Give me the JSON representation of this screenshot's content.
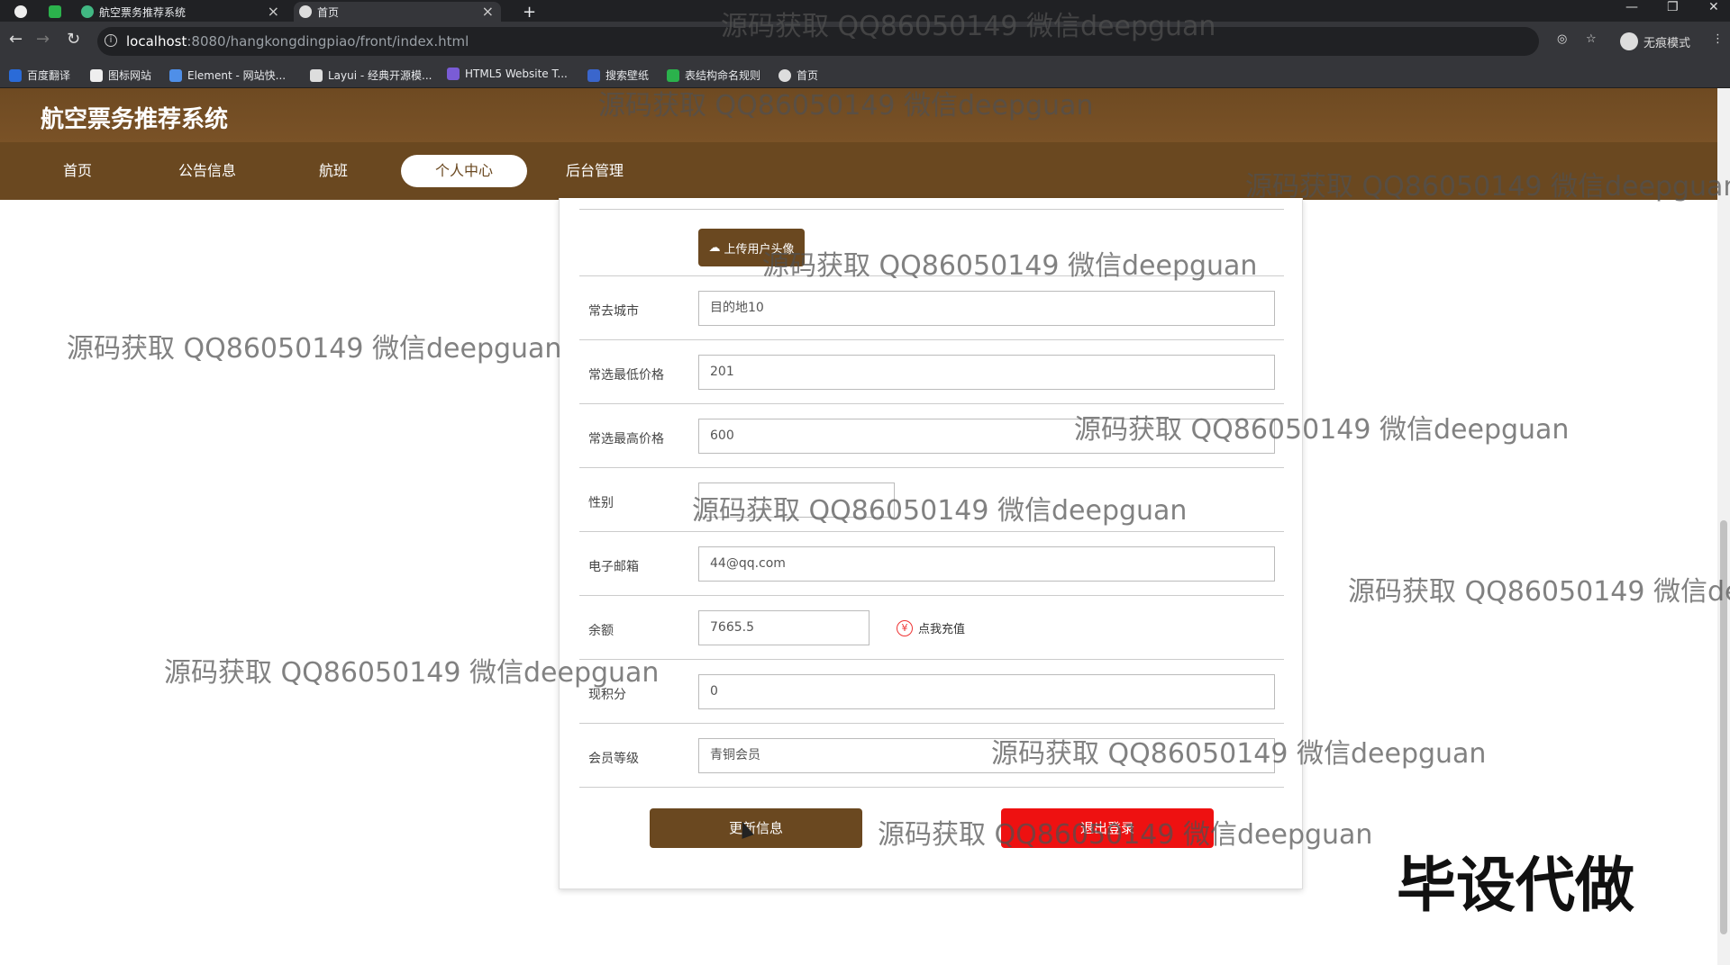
{
  "browser": {
    "tabs": [
      {
        "title": "航空票务推荐系统"
      },
      {
        "title": "首页"
      }
    ],
    "new_tab": "+",
    "url_host": "localhost",
    "url_path": ":8080/hangkongdingpiao/front/index.html",
    "incognito_label": "无痕模式",
    "bookmarks": [
      "百度翻译",
      "图标网站",
      "Element - 网站快...",
      "Layui - 经典开源模...",
      "HTML5 Website T...",
      "搜索壁纸",
      "表结构命名规则",
      "首页"
    ]
  },
  "site": {
    "title": "航空票务推荐系统",
    "nav": [
      "首页",
      "公告信息",
      "航班",
      "个人中心",
      "后台管理"
    ],
    "active_nav": "个人中心"
  },
  "form": {
    "upload_label": "上传用户头像",
    "fields": [
      {
        "label": "常去城市",
        "value": "目的地10"
      },
      {
        "label": "常选最低价格",
        "value": "201"
      },
      {
        "label": "常选最高价格",
        "value": "600"
      },
      {
        "label": "性别",
        "value": ""
      },
      {
        "label": "电子邮箱",
        "value": "44@qq.com"
      },
      {
        "label": "余额",
        "value": "7665.5"
      },
      {
        "label": "现积分",
        "value": "0"
      },
      {
        "label": "会员等级",
        "value": "青铜会员"
      }
    ],
    "recharge_label": "点我充值",
    "update_label": "更新信息",
    "logout_label": "退出登录"
  },
  "watermark_text": "源码获取 QQ86050149 微信deepguan",
  "corner_text": "毕设代做"
}
